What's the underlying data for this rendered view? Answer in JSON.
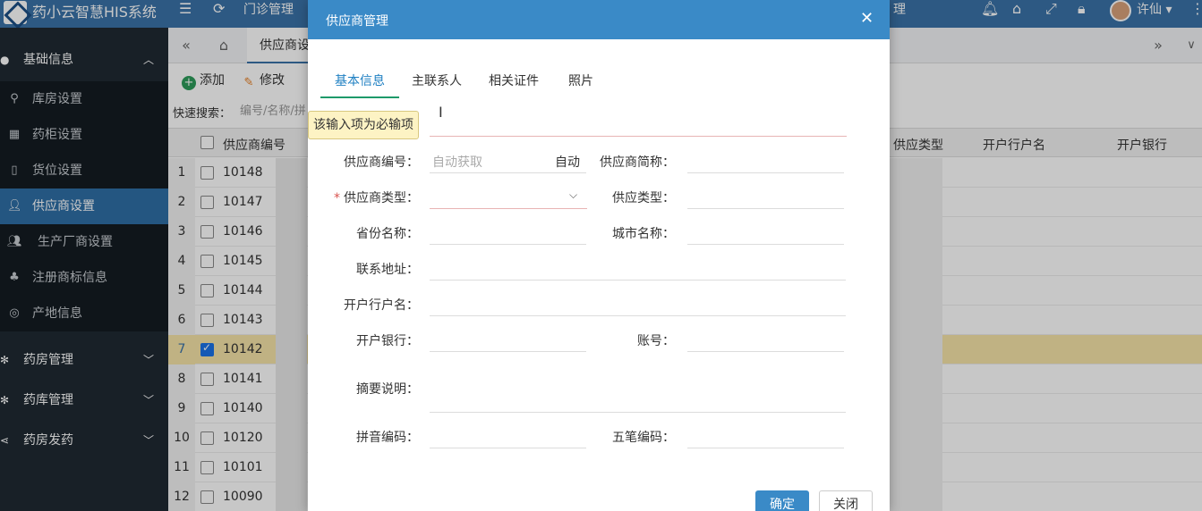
{
  "app": {
    "title": "药小云智慧HIS系统",
    "menu_outpatient": "门诊管理",
    "menu_right": "理",
    "user": "许仙"
  },
  "colors": {
    "header": "#3a73a8",
    "sidebar": "#1f2a33",
    "active": "#2f6fa6",
    "modal_header": "#3a8ac7",
    "selected_row": "#f6e4a8"
  },
  "sidebar": {
    "groups": [
      {
        "label": "基础信息",
        "icon": "circle-icon",
        "chevron": "chevron-up-icon"
      },
      {
        "label": "药房管理",
        "icon": "gear-icon",
        "chevron": "chevron-down-icon"
      },
      {
        "label": "药库管理",
        "icon": "gear-icon",
        "chevron": "chevron-down-icon"
      },
      {
        "label": "药房发药",
        "icon": "share-icon",
        "chevron": "chevron-down-icon"
      }
    ],
    "items": [
      {
        "label": "库房设置",
        "icon": "location-icon"
      },
      {
        "label": "药柜设置",
        "icon": "cabinet-icon"
      },
      {
        "label": "货位设置",
        "icon": "slot-icon"
      },
      {
        "label": "供应商设置",
        "icon": "user-icon"
      },
      {
        "label": "生产厂商设置",
        "icon": "users-icon"
      },
      {
        "label": "注册商标信息",
        "icon": "trademark-icon"
      },
      {
        "label": "产地信息",
        "icon": "pin-icon"
      }
    ]
  },
  "content": {
    "tab_label": "供应商设",
    "toolbar": {
      "add": "添加",
      "edit": "修改"
    },
    "search": {
      "label": "快速搜索：",
      "placeholder": "编号/名称/拼"
    },
    "columns": {
      "code": "供应商编号",
      "type": "供应类型",
      "account_name": "开户行户名",
      "bank": "开户银行"
    },
    "rows": [
      {
        "n": "1",
        "code": "10148",
        "checked": false
      },
      {
        "n": "2",
        "code": "10147",
        "checked": false
      },
      {
        "n": "3",
        "code": "10146",
        "checked": false
      },
      {
        "n": "4",
        "code": "10145",
        "checked": false
      },
      {
        "n": "5",
        "code": "10144",
        "checked": false
      },
      {
        "n": "6",
        "code": "10143",
        "checked": false
      },
      {
        "n": "7",
        "code": "10142",
        "checked": true
      },
      {
        "n": "8",
        "code": "10141",
        "checked": false
      },
      {
        "n": "9",
        "code": "10140",
        "checked": false
      },
      {
        "n": "10",
        "code": "10120",
        "checked": false
      },
      {
        "n": "11",
        "code": "10101",
        "checked": false
      },
      {
        "n": "12",
        "code": "10090",
        "checked": false
      }
    ]
  },
  "modal": {
    "title": "供应商管理",
    "tabs": [
      "基本信息",
      "主联系人",
      "相关证件",
      "照片"
    ],
    "tooltip": "该输入项为必输项",
    "labels": {
      "supplier_code": "供应商编号：",
      "supplier_short": "供应商简称：",
      "supplier_type": "供应商类型：",
      "supply_type": "供应类型：",
      "province": "省份名称：",
      "city": "城市名称：",
      "address": "联系地址：",
      "account_name": "开户行户名：",
      "bank": "开户银行：",
      "account_no": "账号：",
      "summary": "摘要说明：",
      "pinyin": "拼音编码：",
      "wubi": "五笔编码："
    },
    "supplier_code_placeholder": "自动获取",
    "auto_label": "自动",
    "ok": "确定",
    "close": "关闭"
  }
}
